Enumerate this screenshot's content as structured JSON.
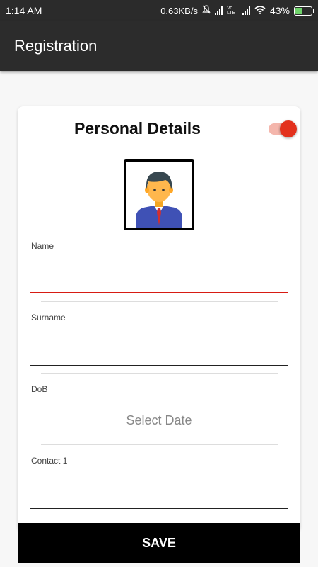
{
  "status_bar": {
    "time": "1:14 AM",
    "network_speed": "0.63KB/s",
    "volte_label": "Vo LTE",
    "battery_percent": "43%",
    "battery_level": 0.43,
    "icons": [
      "mute-icon",
      "signal-icon",
      "signal-icon",
      "wifi-icon",
      "battery-charging-icon"
    ]
  },
  "app_bar": {
    "title": "Registration"
  },
  "card": {
    "title": "Personal Details",
    "toggle_on": true,
    "accent_color": "#e3311d",
    "avatar_icon": "businessman-avatar-icon"
  },
  "form": {
    "name": {
      "label": "Name",
      "value": ""
    },
    "surname": {
      "label": "Surname",
      "value": ""
    },
    "dob": {
      "label": "DoB",
      "button_label": "Select Date"
    },
    "contact1": {
      "label": "Contact 1",
      "value": ""
    }
  },
  "save_button": {
    "label": "SAVE"
  }
}
